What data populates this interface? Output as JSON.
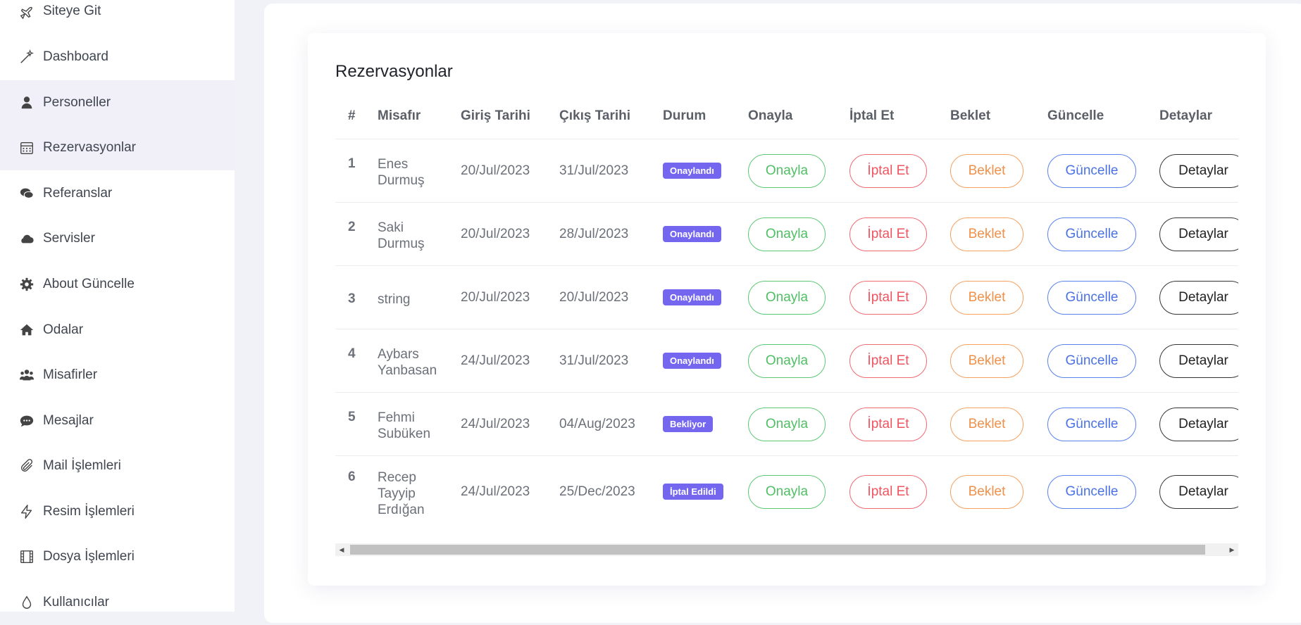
{
  "sidebar": {
    "items": [
      {
        "label": "Siteye Git",
        "icon": "plane-icon"
      },
      {
        "label": "Dashboard",
        "icon": "magic-wand-icon"
      },
      {
        "label": "Personeller",
        "icon": "user-icon"
      },
      {
        "label": "Rezervasyonlar",
        "icon": "calendar-icon"
      },
      {
        "label": "Referanslar",
        "icon": "comments-icon"
      },
      {
        "label": "Servisler",
        "icon": "cloud-icon"
      },
      {
        "label": "About Güncelle",
        "icon": "gear-icon"
      },
      {
        "label": "Odalar",
        "icon": "home-icon"
      },
      {
        "label": "Misafirler",
        "icon": "users-icon"
      },
      {
        "label": "Mesajlar",
        "icon": "comment-dots-icon"
      },
      {
        "label": "Mail İşlemleri",
        "icon": "paperclip-icon"
      },
      {
        "label": "Resim İşlemleri",
        "icon": "bolt-icon"
      },
      {
        "label": "Dosya İşlemleri",
        "icon": "film-icon"
      },
      {
        "label": "Kullanıcılar",
        "icon": "droplet-icon"
      }
    ]
  },
  "card": {
    "title": "Rezervasyonlar"
  },
  "table": {
    "headers": [
      "#",
      "Misafır",
      "Giriş Tarihi",
      "Çıkış Tarihi",
      "Durum",
      "Onayla",
      "İptal Et",
      "Beklet",
      "Güncelle",
      "Detaylar"
    ],
    "rows": [
      {
        "num": "1",
        "name_lines": [
          "Enes",
          "Durmuş"
        ],
        "giris": "20/Jul/2023",
        "cikis": "31/Jul/2023",
        "durum": "Onaylandı"
      },
      {
        "num": "2",
        "name_lines": [
          "Saki",
          "Durmuş"
        ],
        "giris": "20/Jul/2023",
        "cikis": "28/Jul/2023",
        "durum": "Onaylandı"
      },
      {
        "num": "3",
        "name_lines": [
          "string"
        ],
        "giris": "20/Jul/2023",
        "cikis": "20/Jul/2023",
        "durum": "Onaylandı"
      },
      {
        "num": "4",
        "name_lines": [
          "Aybars",
          "Yanbasan"
        ],
        "giris": "24/Jul/2023",
        "cikis": "31/Jul/2023",
        "durum": "Onaylandı"
      },
      {
        "num": "5",
        "name_lines": [
          "Fehmi",
          "Subüken"
        ],
        "giris": "24/Jul/2023",
        "cikis": "04/Aug/2023",
        "durum": "Bekliyor"
      },
      {
        "num": "6",
        "name_lines": [
          "Recep",
          "Tayyip",
          "Erdığan"
        ],
        "giris": "24/Jul/2023",
        "cikis": "25/Dec/2023",
        "durum": "İptal Edildi"
      }
    ],
    "buttons": {
      "onayla": "Onayla",
      "iptal": "İptal Et",
      "beklet": "Beklet",
      "guncelle": "Güncelle",
      "detay": "Detaylar"
    }
  },
  "colors": {
    "badge": "#7566f0",
    "active_nav_bg": "#f1f0f9",
    "page_bg": "#f1f1f8"
  }
}
